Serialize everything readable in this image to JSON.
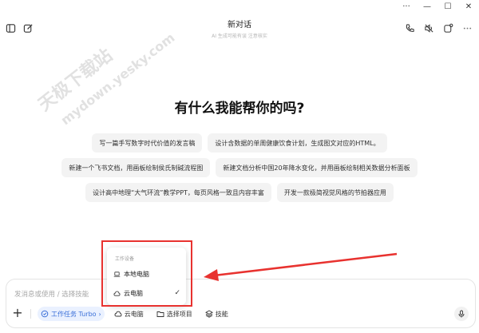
{
  "window": {
    "controls": {
      "more": "···",
      "minimize": "—",
      "maximize": "☐",
      "close": "✕"
    }
  },
  "header": {
    "title": "新对话",
    "subtitle": "AI 生成可能有误 注意核实"
  },
  "watermark": {
    "line1": "天极下载站",
    "line2": "mydown.yesky.com"
  },
  "hero": {
    "text": "有什么我能帮你的吗?"
  },
  "suggestions": [
    [
      "写一篇手写数字时代价值的发言稿",
      "设计含数据的单周健康饮食计划，生成图文对应的HTML。"
    ],
    [
      "新建一个飞书文档，用画板绘制侯氏制碱流程图",
      "新建文档分析中国20年降水变化，并用画板绘制相关数据分析面板"
    ],
    [
      "设计高中地理“大气环流”教学PPT，每页风格一致且内容丰富",
      "开发一款极简视觉风格的节拍器应用"
    ]
  ],
  "composer": {
    "placeholder": "发消息或使用 / 选择技能",
    "plus": "+",
    "mode_label": "工作任务 Turbo",
    "mode_chevron": "›",
    "device_label": "云电脑",
    "project_label": "选择项目",
    "skills_label": "技能"
  },
  "dropdown": {
    "header": "工作设备",
    "items": [
      {
        "label": "本地电脑",
        "selected": false
      },
      {
        "label": "云电脑",
        "selected": true
      }
    ],
    "check": "✓"
  },
  "colors": {
    "accent": "#3a6fd8",
    "annotation": "#e8322f"
  }
}
